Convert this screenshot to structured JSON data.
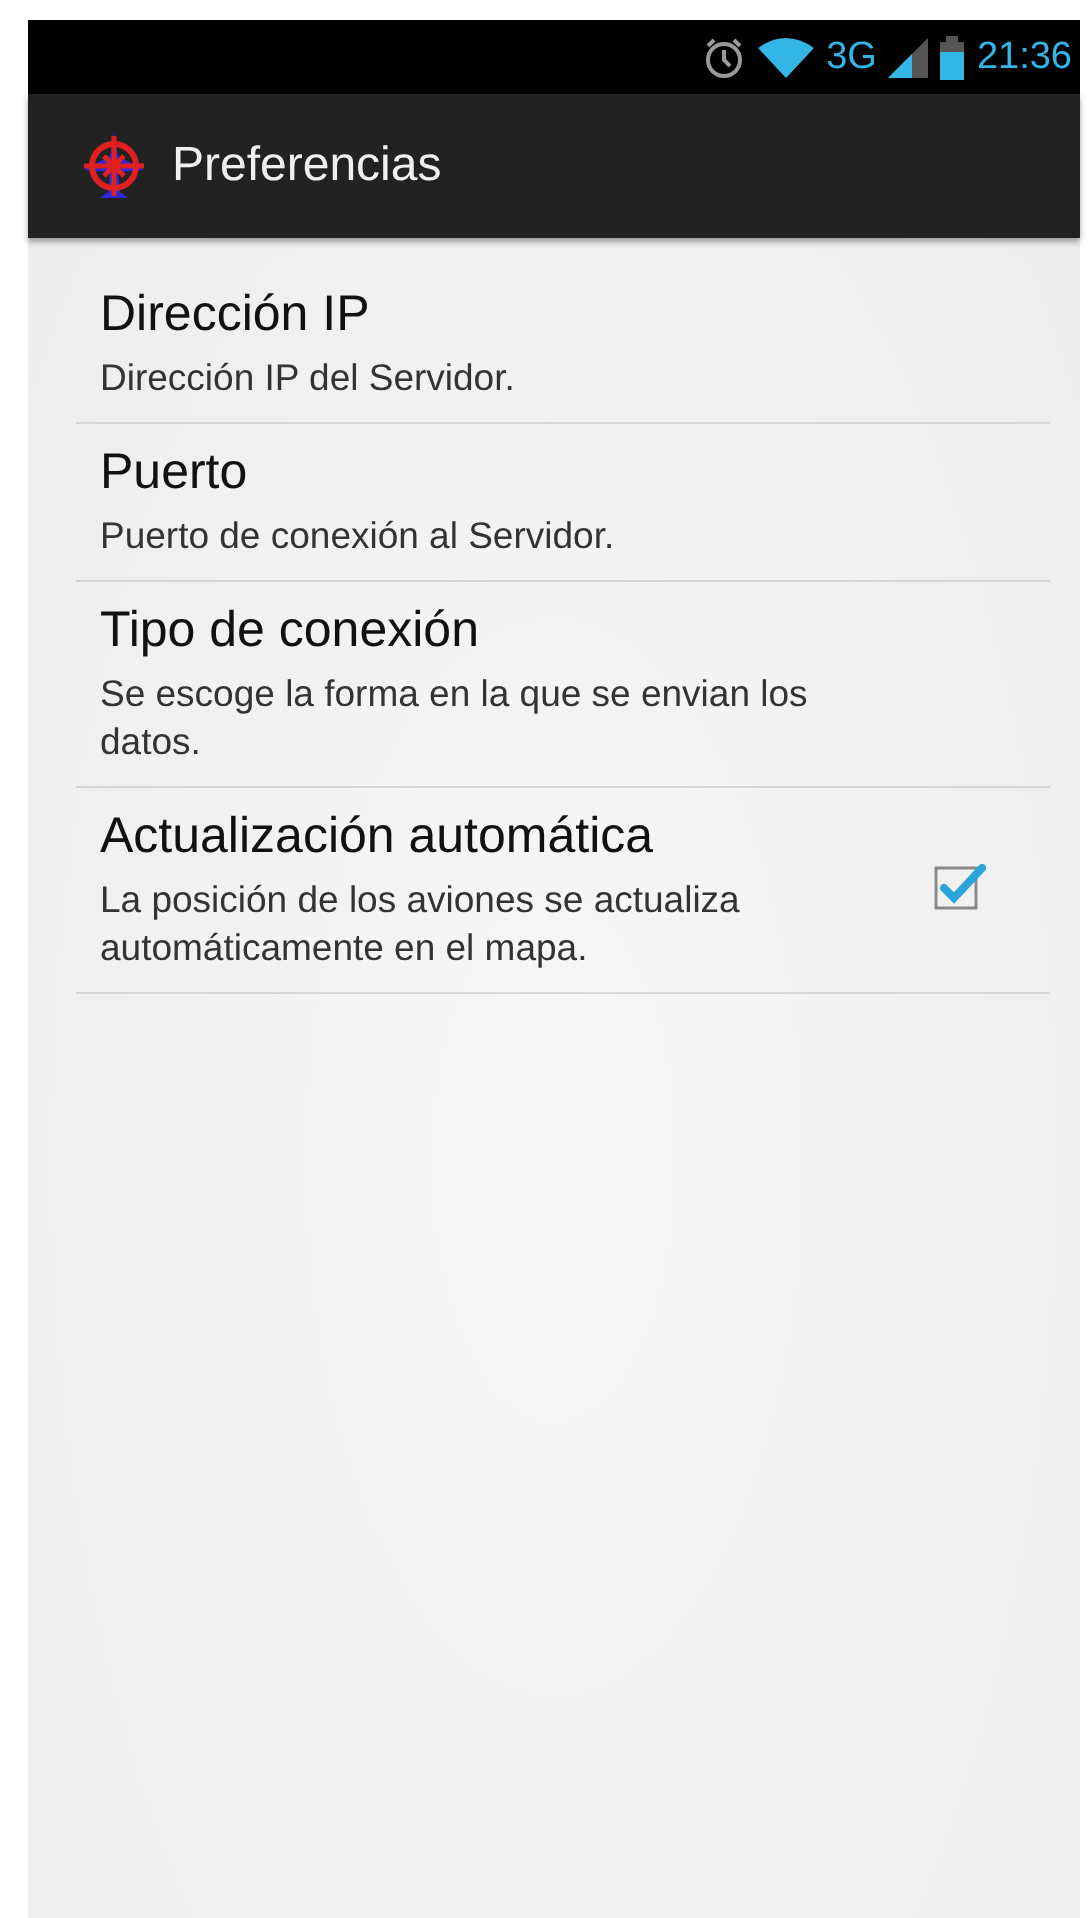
{
  "status_bar": {
    "network": "3G",
    "time": "21:36"
  },
  "action_bar": {
    "title": "Preferencias"
  },
  "preferences": [
    {
      "kind": "text",
      "title": "Dirección IP",
      "summary": "Dirección IP del Servidor."
    },
    {
      "kind": "text",
      "title": "Puerto",
      "summary": "Puerto de conexión al Servidor."
    },
    {
      "kind": "text",
      "title": "Tipo de conexión",
      "summary": "Se escoge la forma en la que se envian los datos."
    },
    {
      "kind": "checkbox",
      "title": "Actualización automática",
      "summary": "La posición de los aviones se actualiza automáticamente en el mapa.",
      "checked": true
    }
  ]
}
